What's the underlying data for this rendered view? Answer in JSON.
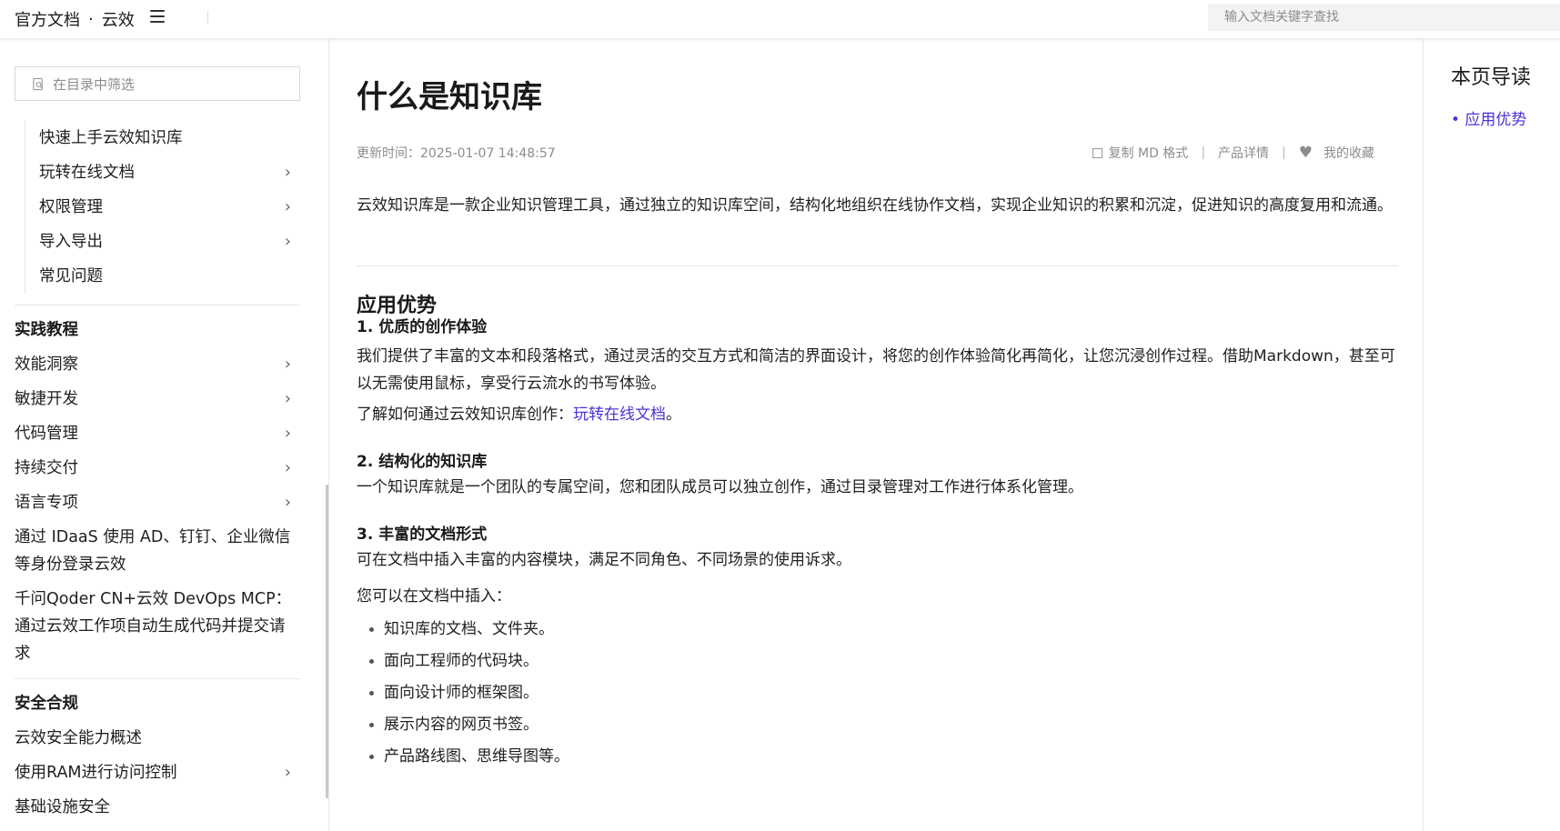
{
  "header": {
    "brand_primary": "官方文档",
    "brand_separator": "·",
    "brand_secondary": "云效",
    "search_placeholder": "输入文档关键字查找"
  },
  "sidebar": {
    "filter_placeholder": "在目录中筛选",
    "sub_items": [
      {
        "label": "快速上手云效知识库",
        "has_children": false
      },
      {
        "label": "玩转在线文档",
        "has_children": true
      },
      {
        "label": "权限管理",
        "has_children": true
      },
      {
        "label": "导入导出",
        "has_children": true
      },
      {
        "label": "常见问题",
        "has_children": false
      }
    ],
    "section_practice": "实践教程",
    "practice_items": [
      {
        "label": "效能洞察",
        "has_children": true
      },
      {
        "label": "敏捷开发",
        "has_children": true
      },
      {
        "label": "代码管理",
        "has_children": true
      },
      {
        "label": "持续交付",
        "has_children": true
      },
      {
        "label": "语言专项",
        "has_children": true
      }
    ],
    "practice_long_1": "通过 IDaaS 使用 AD、钉钉、企业微信等身份登录云效",
    "practice_long_2": "千问Qoder CN+云效 DevOps MCP：通过云效工作项自动生成代码并提交请求",
    "section_security": "安全合规",
    "security_items": [
      {
        "label": "云效安全能力概述",
        "has_children": false
      },
      {
        "label": "使用RAM进行访问控制",
        "has_children": true
      },
      {
        "label": "基础设施安全",
        "has_children": false
      }
    ],
    "chevron": "›"
  },
  "article": {
    "title": "什么是知识库",
    "updated": "更新时间：2025-01-07 14:48:57",
    "actions": {
      "copy_md": "复制 MD 格式",
      "product_detail": "产品详情",
      "favorites": "我的收藏",
      "divider": "|",
      "heart": "♥"
    },
    "intro": "云效知识库是一款企业知识管理工具，通过独立的知识库空间，结构化地组织在线协作文档，实现企业知识的积累和沉淀，促进知识的高度复用和流通。",
    "section_title": "应用优势",
    "point1_title": "1. 优质的创作体验",
    "point1_body": "我们提供了丰富的文本和段落格式，通过灵活的交互方式和简洁的界面设计，将您的创作体验简化再简化，让您沉浸创作过程。借助Markdown，甚至可以无需使用鼠标，享受行云流水的书写体验。",
    "point1_more_prefix": "了解如何通过云效知识库创作：",
    "point1_more_link": "玩转在线文档",
    "point1_more_suffix": "。",
    "point2_title": "2. 结构化的知识库",
    "point2_body": "一个知识库就是一个团队的专属空间，您和团队成员可以独立创作，通过目录管理对工作进行体系化管理。",
    "point3_title": "3. 丰富的文档形式",
    "point3_body": "可在文档中插入丰富的内容模块，满足不同角色、不同场景的使用诉求。",
    "point3_lead": "您可以在文档中插入：",
    "bullets": [
      "知识库的文档、文件夹。",
      "面向工程师的代码块。",
      "面向设计师的框架图。",
      "展示内容的网页书签。",
      "产品路线图、思维导图等。"
    ]
  },
  "right_nav": {
    "title": "本页导读",
    "items": [
      "• 应用优势"
    ]
  },
  "colors": {
    "link": "#4b33d5",
    "muted": "#8c8c8c",
    "text": "#1f1f1f"
  }
}
